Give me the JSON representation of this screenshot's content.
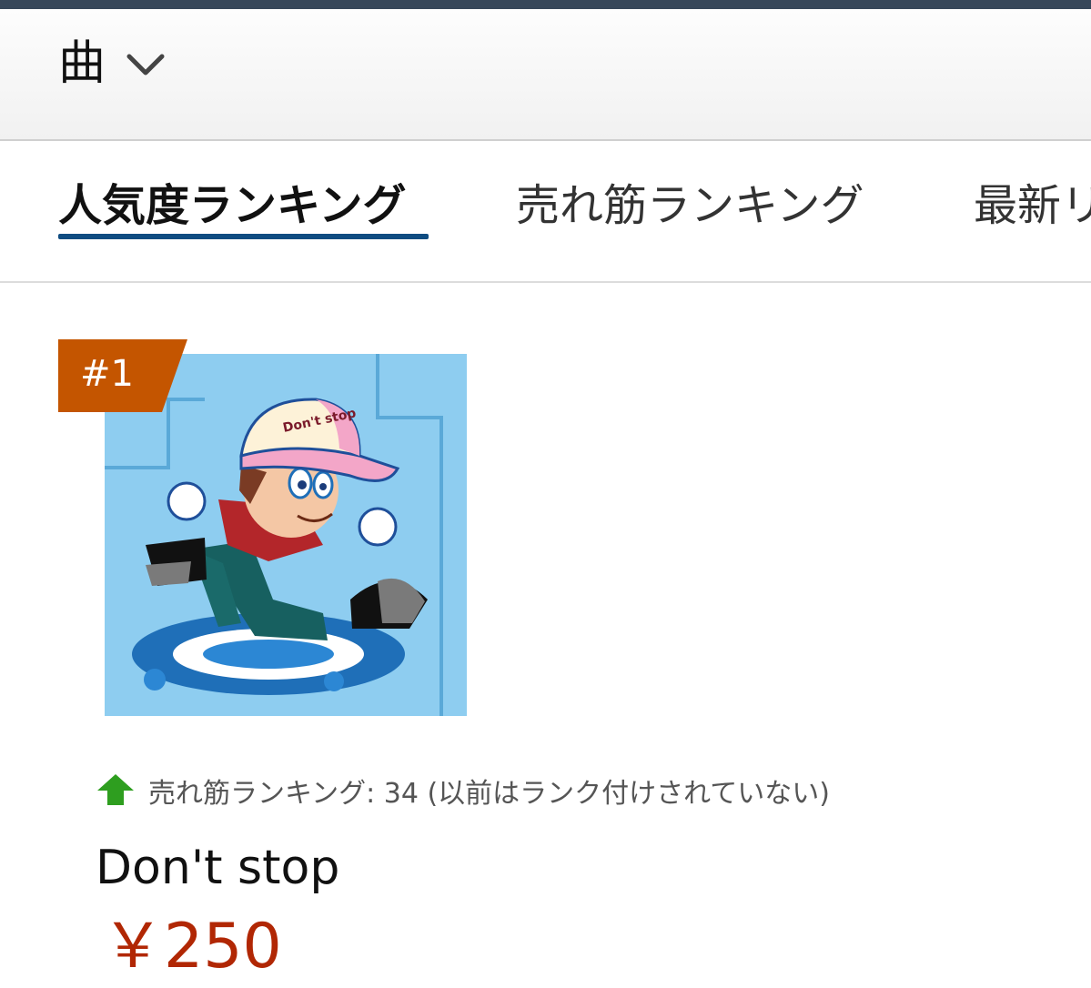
{
  "colors": {
    "topbar": "#37475a",
    "tab_underline": "#0f4c81",
    "rank_badge": "#c45500",
    "trend_up": "#2e9e1f",
    "price": "#b12704"
  },
  "header": {
    "category": "曲",
    "dropdown_icon": "chevron-down-icon"
  },
  "tabs": [
    {
      "label": "人気度ランキング",
      "active": true
    },
    {
      "label": "売れ筋ランキング",
      "active": false
    },
    {
      "label": "最新リ",
      "active": false
    }
  ],
  "item": {
    "rank": "#1",
    "cover_image": "album-art",
    "cover_text": "Don't stop",
    "trend_icon": "arrow-up-icon",
    "trend_text": "売れ筋ランキング: 34 (以前はランク付けされていない)",
    "title": "Don't stop",
    "price": "￥250"
  }
}
